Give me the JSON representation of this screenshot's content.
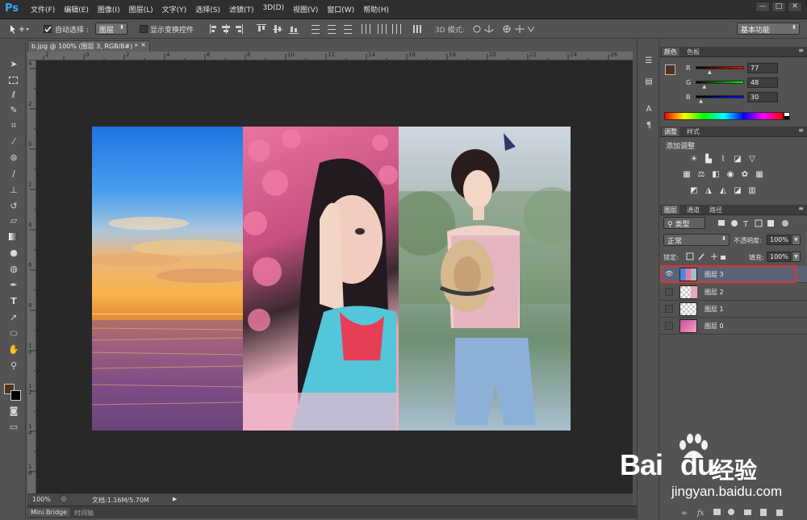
{
  "app": {
    "logo": "Ps"
  },
  "menu": [
    "文件(F)",
    "编辑(E)",
    "图像(I)",
    "图层(L)",
    "文字(Y)",
    "选择(S)",
    "滤镜(T)",
    "3D(D)",
    "视图(V)",
    "窗口(W)",
    "帮助(H)"
  ],
  "window_controls": [
    "—",
    "□",
    "✕"
  ],
  "options": {
    "auto_select_label": "自动选择 :",
    "auto_select_value": "图层",
    "show_transform_label": "显示变换控件",
    "mode_3d_label": "3D 模式:",
    "workspace": "基本功能"
  },
  "document": {
    "tab_title": "b.jpg @ 100% (图层 3, RGB/8#) *",
    "close_glyph": "×",
    "ruler_h_ticks": [
      "2",
      "0",
      "2",
      "4",
      "6",
      "8",
      "10",
      "12",
      "14",
      "16",
      "18",
      "20",
      "22",
      "24",
      "26",
      "28"
    ],
    "ruler_v_ticks": [
      "4",
      "2",
      "0",
      "2",
      "4",
      "6",
      "8",
      "1 0",
      "1 2",
      "1 4",
      "1 6",
      "1 8"
    ],
    "zoom": "100%",
    "doc_size": "文档:1.16M/5.70M"
  },
  "bottom_tabs": [
    "Mini Bridge",
    "时间轴"
  ],
  "color_panel": {
    "tabs": [
      "颜色",
      "色板"
    ],
    "r_label": "R",
    "g_label": "G",
    "b_label": "B",
    "r": "77",
    "g": "48",
    "b": "30",
    "r_level": 0.3,
    "g_level": 0.19,
    "b_level": 0.12,
    "foreground": "#4d301e"
  },
  "adjust_panel": {
    "tabs": [
      "调整",
      "样式"
    ],
    "title": "添加调整"
  },
  "layers_panel": {
    "tabs": [
      "图层",
      "通道",
      "路径"
    ],
    "filter_kind": "类型",
    "blend_mode": "正常",
    "opacity_label": "不透明度:",
    "opacity": "100%",
    "lock_label": "锁定:",
    "fill_label": "填充:",
    "fill": "100%",
    "layers": [
      {
        "name": "图层 3",
        "visible": true,
        "selected": true
      },
      {
        "name": "图层 2",
        "visible": false,
        "selected": false
      },
      {
        "name": "图层 1",
        "visible": false,
        "selected": false
      },
      {
        "name": "图层 0",
        "visible": false,
        "selected": false
      }
    ]
  },
  "watermark": {
    "brand": "Bai",
    "brand_du": "du",
    "cn": "经验",
    "url": "jingyan.baidu.com"
  },
  "colors": {
    "selection_outline": "#e0322c",
    "ps_blue": "#31a8ff"
  }
}
